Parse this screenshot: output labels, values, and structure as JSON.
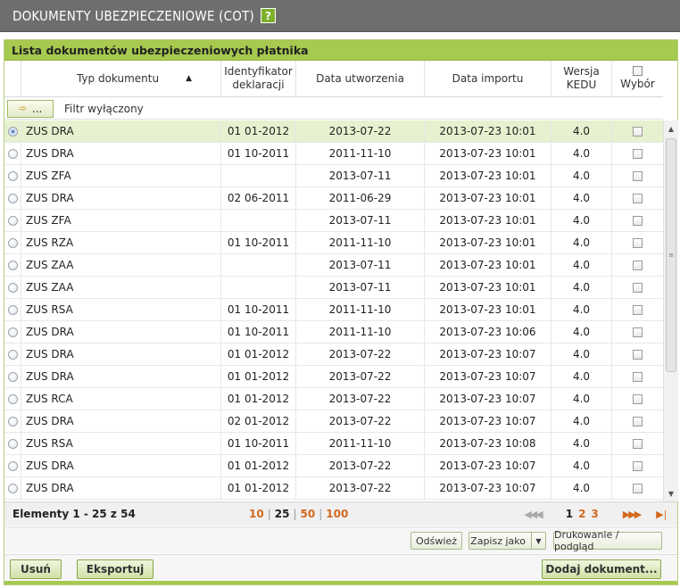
{
  "app": {
    "title": "DOKUMENTY UBEZPIECZENIOWE (COT)",
    "help_label": "?"
  },
  "panel": {
    "title": "Lista dokumentów ubezpieczeniowych płatnika"
  },
  "columns": {
    "typ": "Typ dokumentu",
    "sort_indicator": "▲",
    "id_line1": "Identyfikator",
    "id_line2": "deklaracji",
    "data_utworzenia": "Data utworzenia",
    "data_importu": "Data importu",
    "wersja_line1": "Wersja",
    "wersja_line2": "KEDU",
    "wybor": "Wybór"
  },
  "filter": {
    "button_label": "...",
    "status": "Filtr wyłączony"
  },
  "rows": [
    {
      "typ": "ZUS DRA",
      "id": "01 01-2012",
      "utw": "2013-07-22",
      "imp": "2013-07-23 10:01",
      "ver": "4.0",
      "selected": true
    },
    {
      "typ": "ZUS DRA",
      "id": "01 10-2011",
      "utw": "2011-11-10",
      "imp": "2013-07-23 10:01",
      "ver": "4.0"
    },
    {
      "typ": "ZUS ZFA",
      "id": "",
      "utw": "2013-07-11",
      "imp": "2013-07-23 10:01",
      "ver": "4.0"
    },
    {
      "typ": "ZUS DRA",
      "id": "02 06-2011",
      "utw": "2011-06-29",
      "imp": "2013-07-23 10:01",
      "ver": "4.0"
    },
    {
      "typ": "ZUS ZFA",
      "id": "",
      "utw": "2013-07-11",
      "imp": "2013-07-23 10:01",
      "ver": "4.0"
    },
    {
      "typ": "ZUS RZA",
      "id": "01 10-2011",
      "utw": "2011-11-10",
      "imp": "2013-07-23 10:01",
      "ver": "4.0"
    },
    {
      "typ": "ZUS ZAA",
      "id": "",
      "utw": "2013-07-11",
      "imp": "2013-07-23 10:01",
      "ver": "4.0"
    },
    {
      "typ": "ZUS ZAA",
      "id": "",
      "utw": "2013-07-11",
      "imp": "2013-07-23 10:01",
      "ver": "4.0"
    },
    {
      "typ": "ZUS RSA",
      "id": "01 10-2011",
      "utw": "2011-11-10",
      "imp": "2013-07-23 10:01",
      "ver": "4.0"
    },
    {
      "typ": "ZUS DRA",
      "id": "01 10-2011",
      "utw": "2011-11-10",
      "imp": "2013-07-23 10:06",
      "ver": "4.0"
    },
    {
      "typ": "ZUS DRA",
      "id": "01 01-2012",
      "utw": "2013-07-22",
      "imp": "2013-07-23 10:07",
      "ver": "4.0"
    },
    {
      "typ": "ZUS DRA",
      "id": "01 01-2012",
      "utw": "2013-07-22",
      "imp": "2013-07-23 10:07",
      "ver": "4.0"
    },
    {
      "typ": "ZUS RCA",
      "id": "01 01-2012",
      "utw": "2013-07-22",
      "imp": "2013-07-23 10:07",
      "ver": "4.0"
    },
    {
      "typ": "ZUS DRA",
      "id": "02 01-2012",
      "utw": "2013-07-22",
      "imp": "2013-07-23 10:07",
      "ver": "4.0"
    },
    {
      "typ": "ZUS RSA",
      "id": "01 10-2011",
      "utw": "2011-11-10",
      "imp": "2013-07-23 10:08",
      "ver": "4.0"
    },
    {
      "typ": "ZUS DRA",
      "id": "01 01-2012",
      "utw": "2013-07-22",
      "imp": "2013-07-23 10:07",
      "ver": "4.0"
    },
    {
      "typ": "ZUS DRA",
      "id": "01 01-2012",
      "utw": "2013-07-22",
      "imp": "2013-07-23 10:07",
      "ver": "4.0"
    }
  ],
  "pager": {
    "elements": "Elementy 1 - 25 z 54",
    "sizes": [
      "10",
      "25",
      "50",
      "100"
    ],
    "current_size": "25",
    "pages": [
      "1",
      "2",
      "3"
    ],
    "current_page": "1",
    "first": "◀◀◀",
    "next": "▶▶▶",
    "last": "▶|"
  },
  "actions": {
    "refresh": "Odśwież",
    "save_as": "Zapisz jako",
    "print": "Drukowanie / podgląd"
  },
  "footer": {
    "delete": "Usuń",
    "export": "Eksportuj",
    "add": "Dodaj dokument..."
  }
}
